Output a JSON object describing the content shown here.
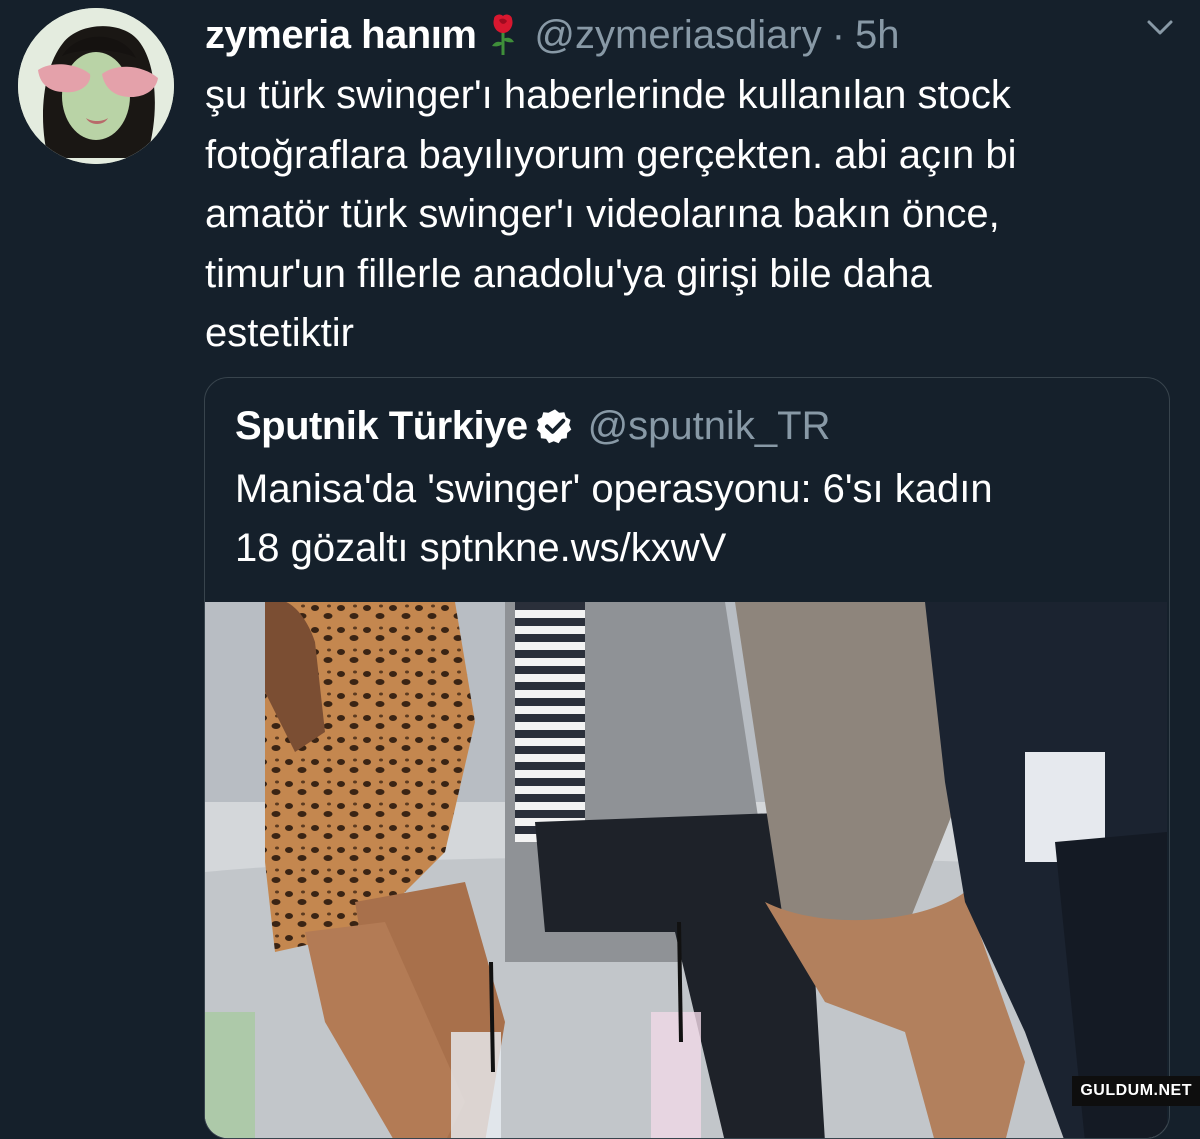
{
  "tweet": {
    "display_name": "zymeria hanım",
    "handle": "@zymeriasdiary",
    "separator": "·",
    "time": "5h",
    "text_lines": [
      "şu türk swinger'ı haberlerinde kullanılan stock",
      "fotoğraflara bayılıyorum gerçekten. abi açın bi",
      "amatör türk swinger'ı videolarına bakın önce,",
      "timur'un fillerle anadolu'ya girişi bile daha",
      "estetiktir"
    ]
  },
  "quoted_tweet": {
    "display_name": "Sputnik Türkiye",
    "handle": "@sputnik_TR",
    "text_lines": [
      "Manisa'da 'swinger' operasyonu: 6'sı kadın",
      "18 gözaltı sptnkne.ws/kxwV"
    ]
  },
  "icons": {
    "name_emoji": "rose-icon",
    "verified": "verified-badge-icon",
    "menu": "chevron-down-icon"
  },
  "watermark": "GULDUM.NET",
  "colors": {
    "background": "#15202b",
    "primary_text": "#ffffff",
    "secondary_text": "#8899a6",
    "border": "#38444d"
  }
}
